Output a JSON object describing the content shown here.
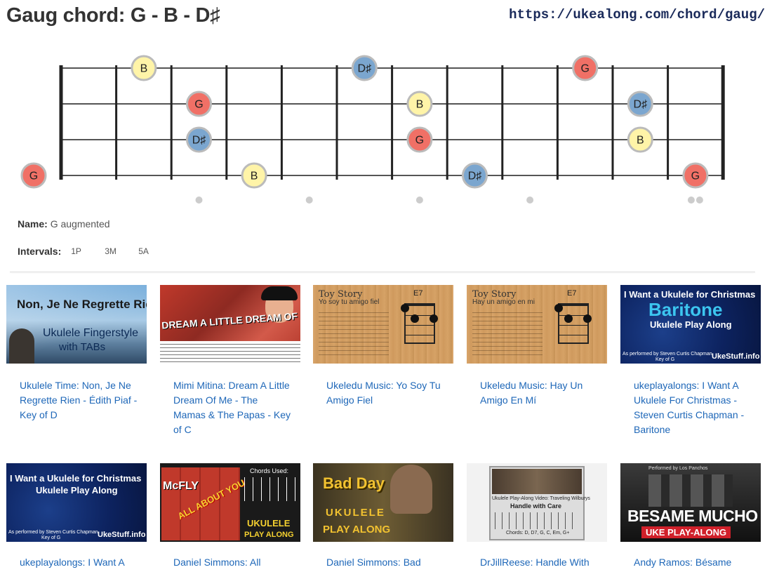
{
  "page": {
    "title": "Gaug chord: G - B - D♯",
    "url": "https://ukealong.com/chord/gaug/"
  },
  "chord": {
    "name_label": "Name:",
    "name": "G augmented",
    "intervals_label": "Intervals:",
    "intervals": [
      "1P",
      "3M",
      "5A"
    ]
  },
  "colors": {
    "G": "#f07066",
    "B": "#fff4a8",
    "D♯": "#7ba6cf"
  },
  "fretboard": {
    "strings": 4,
    "frets": 12,
    "inlay_frets": [
      3,
      5,
      7,
      9
    ],
    "double_inlay_fret": 12,
    "notes": [
      {
        "string": 1,
        "fret": 2,
        "note": "B"
      },
      {
        "string": 1,
        "fret": 6,
        "note": "D♯"
      },
      {
        "string": 1,
        "fret": 10,
        "note": "G"
      },
      {
        "string": 2,
        "fret": 3,
        "note": "G"
      },
      {
        "string": 2,
        "fret": 7,
        "note": "B"
      },
      {
        "string": 2,
        "fret": 11,
        "note": "D♯"
      },
      {
        "string": 3,
        "fret": 3,
        "note": "D♯"
      },
      {
        "string": 3,
        "fret": 7,
        "note": "G"
      },
      {
        "string": 3,
        "fret": 11,
        "note": "B"
      },
      {
        "string": 4,
        "fret": 0,
        "note": "G"
      },
      {
        "string": 4,
        "fret": 4,
        "note": "B"
      },
      {
        "string": 4,
        "fret": 8,
        "note": "D♯"
      },
      {
        "string": 4,
        "fret": 12,
        "note": "G"
      }
    ]
  },
  "videos": [
    {
      "title": "Ukulele Time: Non, Je Ne Regrette Rien - Édith Piaf - Key of D",
      "thumb_text": [
        "Non, Je Ne Regrette Rien",
        "Ukulele Fingerstyle",
        "with TABs"
      ]
    },
    {
      "title": "Mimi Mitina: Dream A Little Dream Of Me - The Mamas & The Papas - Key of C",
      "thumb_text": [
        "DREAM A LITTLE DREAM OF ME"
      ]
    },
    {
      "title": "Ukeledu Music: Yo Soy Tu Amigo Fiel",
      "thumb_text": [
        "Toy Story",
        "Yo soy tu amigo fiel",
        "E7"
      ]
    },
    {
      "title": "Ukeledu Music: Hay Un Amigo En Mí",
      "thumb_text": [
        "Toy Story",
        "Hay un amigo en mi",
        "E7"
      ]
    },
    {
      "title": "ukeplayalongs: I Want A Ukulele For Christmas - Steven Curtis Chapman - Baritone",
      "thumb_text": [
        "I Want a Ukulele for Christmas",
        "Baritone",
        "Ukulele Play Along",
        "As performed by Steven Curtis Chapman",
        "Key of G",
        "UkeStuff.info"
      ]
    },
    {
      "title": "ukeplayalongs: I Want A",
      "thumb_text": [
        "I Want a Ukulele for Christmas",
        "Ukulele Play Along",
        "As performed by Steven Curtis Chapman",
        "Key of G",
        "UkeStuff.info"
      ]
    },
    {
      "title": "Daniel Simmons: All",
      "thumb_text": [
        "McFLY",
        "ALL ABOUT YOU",
        "Chords Used:",
        "UKULELE",
        "PLAY ALONG"
      ]
    },
    {
      "title": "Daniel Simmons: Bad",
      "thumb_text": [
        "Bad Day",
        "UKULELE",
        "PLAY ALONG"
      ]
    },
    {
      "title": "DrJillReese: Handle With",
      "thumb_text": [
        "Ukulele Play-Along Video: Traveling Wilburys",
        "Handle with Care",
        "Chords: D, D7, G, C, Em, G+"
      ]
    },
    {
      "title": "Andy Ramos: Bésame",
      "thumb_text": [
        "Performed by Los Panchos",
        "BESAME MUCHO",
        "UKE PLAY-ALONG"
      ]
    }
  ]
}
